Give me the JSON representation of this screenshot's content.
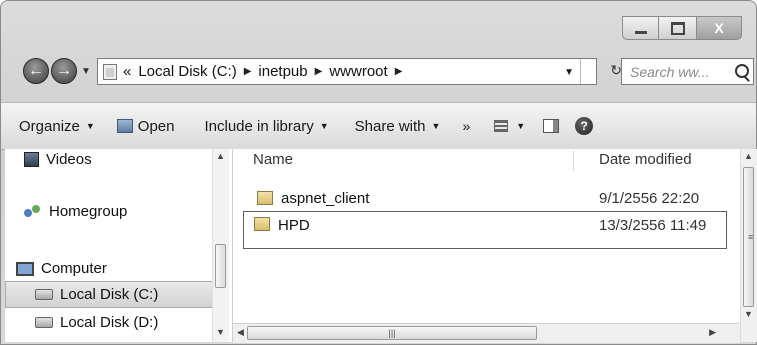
{
  "address": {
    "overflow_label": "«",
    "crumbs": [
      "Local Disk (C:)",
      "inetpub",
      "wwwroot"
    ],
    "search_placeholder": "Search ww..."
  },
  "toolbar": {
    "organize": "Organize",
    "open": "Open",
    "include_in_library": "Include in library",
    "share_with": "Share with",
    "more": "»"
  },
  "navpane": {
    "items": [
      {
        "label": "Videos",
        "icon": "videos-icon"
      },
      {
        "label": "Homegroup",
        "icon": "homegroup-icon"
      },
      {
        "label": "Computer",
        "icon": "computer-icon"
      },
      {
        "label": "Local Disk (C:)",
        "icon": "disk-icon",
        "selected": true
      },
      {
        "label": "Local Disk (D:)",
        "icon": "disk-icon"
      }
    ]
  },
  "columns": {
    "name": "Name",
    "date_modified": "Date modified"
  },
  "files": [
    {
      "name": "aspnet_client",
      "date": "9/1/2556 22:20",
      "selected": false
    },
    {
      "name": "HPD",
      "date": "13/3/2556 11:49",
      "selected": true
    }
  ]
}
